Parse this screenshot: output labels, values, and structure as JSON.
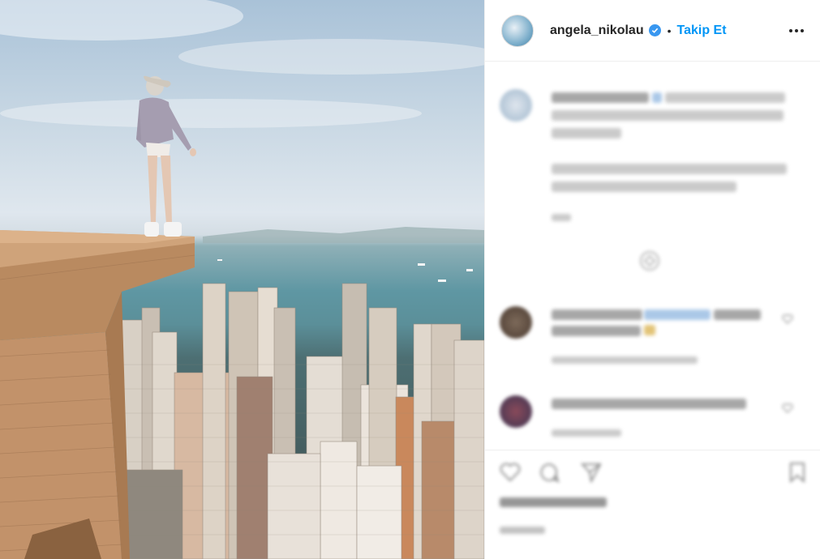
{
  "header": {
    "username": "angela_nikolau",
    "separator": "•",
    "follow_label": "Takip Et"
  },
  "colors": {
    "follow": "#0095f6",
    "verified": "#3897f0",
    "text": "#262626"
  },
  "icons": [
    "verified-badge-icon",
    "more-options-icon",
    "heart-icon",
    "comment-icon",
    "share-icon",
    "bookmark-icon"
  ]
}
